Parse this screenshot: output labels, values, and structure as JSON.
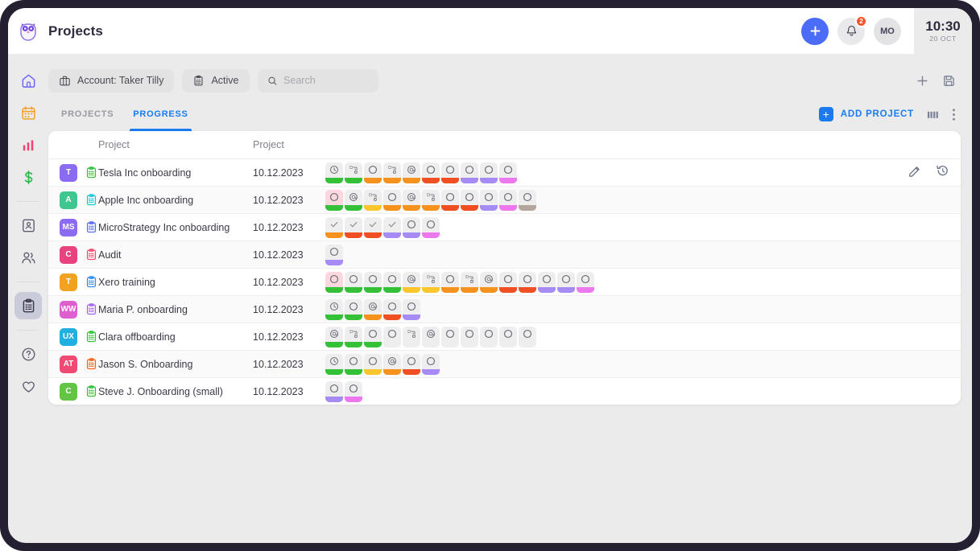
{
  "topbar": {
    "logo": "owl-logo-icon",
    "title": "Projects",
    "add_label": "+",
    "notifications_count": "2",
    "user_initials": "MO",
    "time": "10:30",
    "date": "20 OCT"
  },
  "sidebar": {
    "items": [
      {
        "name": "home",
        "icon": "home-icon",
        "color": "#6c63ff",
        "active": false
      },
      {
        "name": "calendar",
        "icon": "calendar-icon",
        "color": "#f59b1a",
        "active": false
      },
      {
        "name": "analytics",
        "icon": "bar-chart-icon",
        "color": "#f4436c",
        "active": false
      },
      {
        "name": "finance",
        "icon": "dollar-icon",
        "color": "#2eb94f",
        "active": false
      },
      {
        "name": "divider-1",
        "icon": "divider",
        "color": "",
        "active": false
      },
      {
        "name": "contacts",
        "icon": "id-card-icon",
        "color": "#5c5a6e",
        "active": false
      },
      {
        "name": "team",
        "icon": "people-icon",
        "color": "#5c5a6e",
        "active": false
      },
      {
        "name": "divider-2",
        "icon": "divider",
        "color": "",
        "active": false
      },
      {
        "name": "projects",
        "icon": "clipboard-icon",
        "color": "#3b3a4a",
        "active": true
      },
      {
        "name": "divider-3",
        "icon": "divider",
        "color": "",
        "active": false
      },
      {
        "name": "help",
        "icon": "question-circle-icon",
        "color": "#5c5a6e",
        "active": false
      },
      {
        "name": "favorites",
        "icon": "heart-icon",
        "color": "#5c5a6e",
        "active": false
      }
    ]
  },
  "filters": {
    "account": {
      "label": "Account: Taker Tilly",
      "icon": "briefcase-icon"
    },
    "status": {
      "label": "Active",
      "icon": "clipboard-list-icon"
    },
    "search": {
      "placeholder": "Search",
      "value": "",
      "icon": "search-icon"
    },
    "add_icon": "plus-icon",
    "save_icon": "save-icon"
  },
  "tabs": [
    {
      "label": "PROJECTS",
      "active": false
    },
    {
      "label": "PROGRESS",
      "active": true
    }
  ],
  "tabs_right": {
    "add_project_label": "ADD PROJECT",
    "add_project_icon": "plus-square-icon",
    "columns_icon": "columns-icon",
    "more_icon": "more-vertical-icon"
  },
  "table": {
    "headers": {
      "project_name": "Project",
      "project_date": "Project"
    },
    "row_actions": {
      "edit_icon": "pencil-icon",
      "history_icon": "history-icon"
    },
    "rows": [
      {
        "initials": "T",
        "avatar_color": "#8a6bf2",
        "clip_color": "#34c138",
        "name": "Tesla Inc onboarding",
        "date": "10.12.2023",
        "chips": [
          {
            "icon": "clock",
            "bar": "#34c138",
            "hl": false
          },
          {
            "icon": "flow",
            "bar": "#34c138",
            "hl": false
          },
          {
            "icon": "circle",
            "bar": "#f5921e",
            "hl": false
          },
          {
            "icon": "flow",
            "bar": "#f5921e",
            "hl": false
          },
          {
            "icon": "at",
            "bar": "#f5921e",
            "hl": false
          },
          {
            "icon": "circle",
            "bar": "#f04e23",
            "hl": false
          },
          {
            "icon": "circle",
            "bar": "#f04e23",
            "hl": false
          },
          {
            "icon": "circle",
            "bar": "#a78bf5",
            "hl": false
          },
          {
            "icon": "circle",
            "bar": "#a78bf5",
            "hl": false
          },
          {
            "icon": "circle",
            "bar": "#ed78ee",
            "hl": false
          }
        ]
      },
      {
        "initials": "A",
        "avatar_color": "#3fc78f",
        "clip_color": "#17c9d4",
        "name": "Apple Inc onboarding",
        "date": "10.12.2023",
        "chips": [
          {
            "icon": "circle",
            "bar": "#34c138",
            "hl": true
          },
          {
            "icon": "at",
            "bar": "#34c138",
            "hl": false
          },
          {
            "icon": "flow",
            "bar": "#fbc62c",
            "hl": false
          },
          {
            "icon": "circle",
            "bar": "#f5921e",
            "hl": false
          },
          {
            "icon": "at",
            "bar": "#f5921e",
            "hl": false
          },
          {
            "icon": "flow",
            "bar": "#f5921e",
            "hl": false
          },
          {
            "icon": "circle",
            "bar": "#f04e23",
            "hl": false
          },
          {
            "icon": "circle",
            "bar": "#f04e23",
            "hl": false
          },
          {
            "icon": "circle",
            "bar": "#a78bf5",
            "hl": false
          },
          {
            "icon": "circle",
            "bar": "#ed78ee",
            "hl": false
          },
          {
            "icon": "circle",
            "bar": "#b3a79b",
            "hl": false
          }
        ]
      },
      {
        "initials": "MS",
        "avatar_color": "#8a6bf2",
        "clip_color": "#5a6cf0",
        "name": "MicroStrategy Inc onboarding",
        "date": "10.12.2023",
        "chips": [
          {
            "icon": "check",
            "bar": "#f5921e",
            "hl": false
          },
          {
            "icon": "check",
            "bar": "#f04e23",
            "hl": false
          },
          {
            "icon": "check",
            "bar": "#f04e23",
            "hl": false
          },
          {
            "icon": "check",
            "bar": "#a78bf5",
            "hl": false
          },
          {
            "icon": "circle",
            "bar": "#a78bf5",
            "hl": false
          },
          {
            "icon": "circle",
            "bar": "#ed78ee",
            "hl": false
          }
        ]
      },
      {
        "initials": "C",
        "avatar_color": "#e8437f",
        "clip_color": "#f4486e",
        "name": "Audit",
        "date": "10.12.2023",
        "chips": [
          {
            "icon": "circle",
            "bar": "#a78bf5",
            "hl": false
          }
        ]
      },
      {
        "initials": "T",
        "avatar_color": "#f0a320",
        "clip_color": "#2f8bf0",
        "name": "Xero training",
        "date": "10.12.2023",
        "chips": [
          {
            "icon": "circle",
            "bar": "#34c138",
            "hl": true
          },
          {
            "icon": "circle",
            "bar": "#34c138",
            "hl": false
          },
          {
            "icon": "circle",
            "bar": "#34c138",
            "hl": false
          },
          {
            "icon": "circle",
            "bar": "#34c138",
            "hl": false
          },
          {
            "icon": "at",
            "bar": "#fbc62c",
            "hl": false
          },
          {
            "icon": "flow",
            "bar": "#fbc62c",
            "hl": false
          },
          {
            "icon": "circle",
            "bar": "#f5921e",
            "hl": false
          },
          {
            "icon": "flow",
            "bar": "#f5921e",
            "hl": false
          },
          {
            "icon": "at",
            "bar": "#f5921e",
            "hl": false
          },
          {
            "icon": "circle",
            "bar": "#f04e23",
            "hl": false
          },
          {
            "icon": "circle",
            "bar": "#f04e23",
            "hl": false
          },
          {
            "icon": "circle",
            "bar": "#a78bf5",
            "hl": false
          },
          {
            "icon": "circle",
            "bar": "#a78bf5",
            "hl": false
          },
          {
            "icon": "circle",
            "bar": "#ed78ee",
            "hl": false
          }
        ]
      },
      {
        "initials": "WW",
        "avatar_color": "#e05fd0",
        "clip_color": "#a365f0",
        "name": "Maria P. onboarding",
        "date": "10.12.2023",
        "chips": [
          {
            "icon": "clock",
            "bar": "#34c138",
            "hl": false
          },
          {
            "icon": "circle",
            "bar": "#34c138",
            "hl": false
          },
          {
            "icon": "at",
            "bar": "#f5921e",
            "hl": false
          },
          {
            "icon": "circle",
            "bar": "#f04e23",
            "hl": false
          },
          {
            "icon": "circle",
            "bar": "#a78bf5",
            "hl": false
          }
        ]
      },
      {
        "initials": "UX",
        "avatar_color": "#1fafe0",
        "clip_color": "#34c138",
        "name": "Clara offboarding",
        "date": "10.12.2023",
        "chips": [
          {
            "icon": "at",
            "bar": "#34c138",
            "hl": false
          },
          {
            "icon": "flow",
            "bar": "#34c138",
            "hl": false
          },
          {
            "icon": "circle",
            "bar": "#34c138",
            "hl": false
          },
          {
            "icon": "circle",
            "bar": "",
            "hl": false
          },
          {
            "icon": "flow",
            "bar": "",
            "hl": false
          },
          {
            "icon": "at",
            "bar": "",
            "hl": false
          },
          {
            "icon": "circle",
            "bar": "",
            "hl": false
          },
          {
            "icon": "circle",
            "bar": "",
            "hl": false
          },
          {
            "icon": "circle",
            "bar": "",
            "hl": false
          },
          {
            "icon": "circle",
            "bar": "",
            "hl": false
          },
          {
            "icon": "circle",
            "bar": "",
            "hl": false
          }
        ]
      },
      {
        "initials": "AT",
        "avatar_color": "#ef4a73",
        "clip_color": "#f4631d",
        "name": "Jason S. Onboarding",
        "date": "10.12.2023",
        "chips": [
          {
            "icon": "clock",
            "bar": "#34c138",
            "hl": false
          },
          {
            "icon": "circle",
            "bar": "#34c138",
            "hl": false
          },
          {
            "icon": "circle",
            "bar": "#fbc62c",
            "hl": false
          },
          {
            "icon": "at",
            "bar": "#f5921e",
            "hl": false
          },
          {
            "icon": "circle",
            "bar": "#f04e23",
            "hl": false
          },
          {
            "icon": "circle",
            "bar": "#a78bf5",
            "hl": false
          }
        ]
      },
      {
        "initials": "C",
        "avatar_color": "#63c445",
        "clip_color": "#34c138",
        "name": "Steve J. Onboarding (small)",
        "date": "10.12.2023",
        "chips": [
          {
            "icon": "circle",
            "bar": "#a78bf5",
            "hl": false
          },
          {
            "icon": "circle",
            "bar": "#ed78ee",
            "hl": false
          }
        ]
      }
    ]
  },
  "colors": {
    "accent_blue": "#1a7bf0",
    "fab_blue": "#4a6cf7",
    "badge_red": "#f4522a"
  }
}
